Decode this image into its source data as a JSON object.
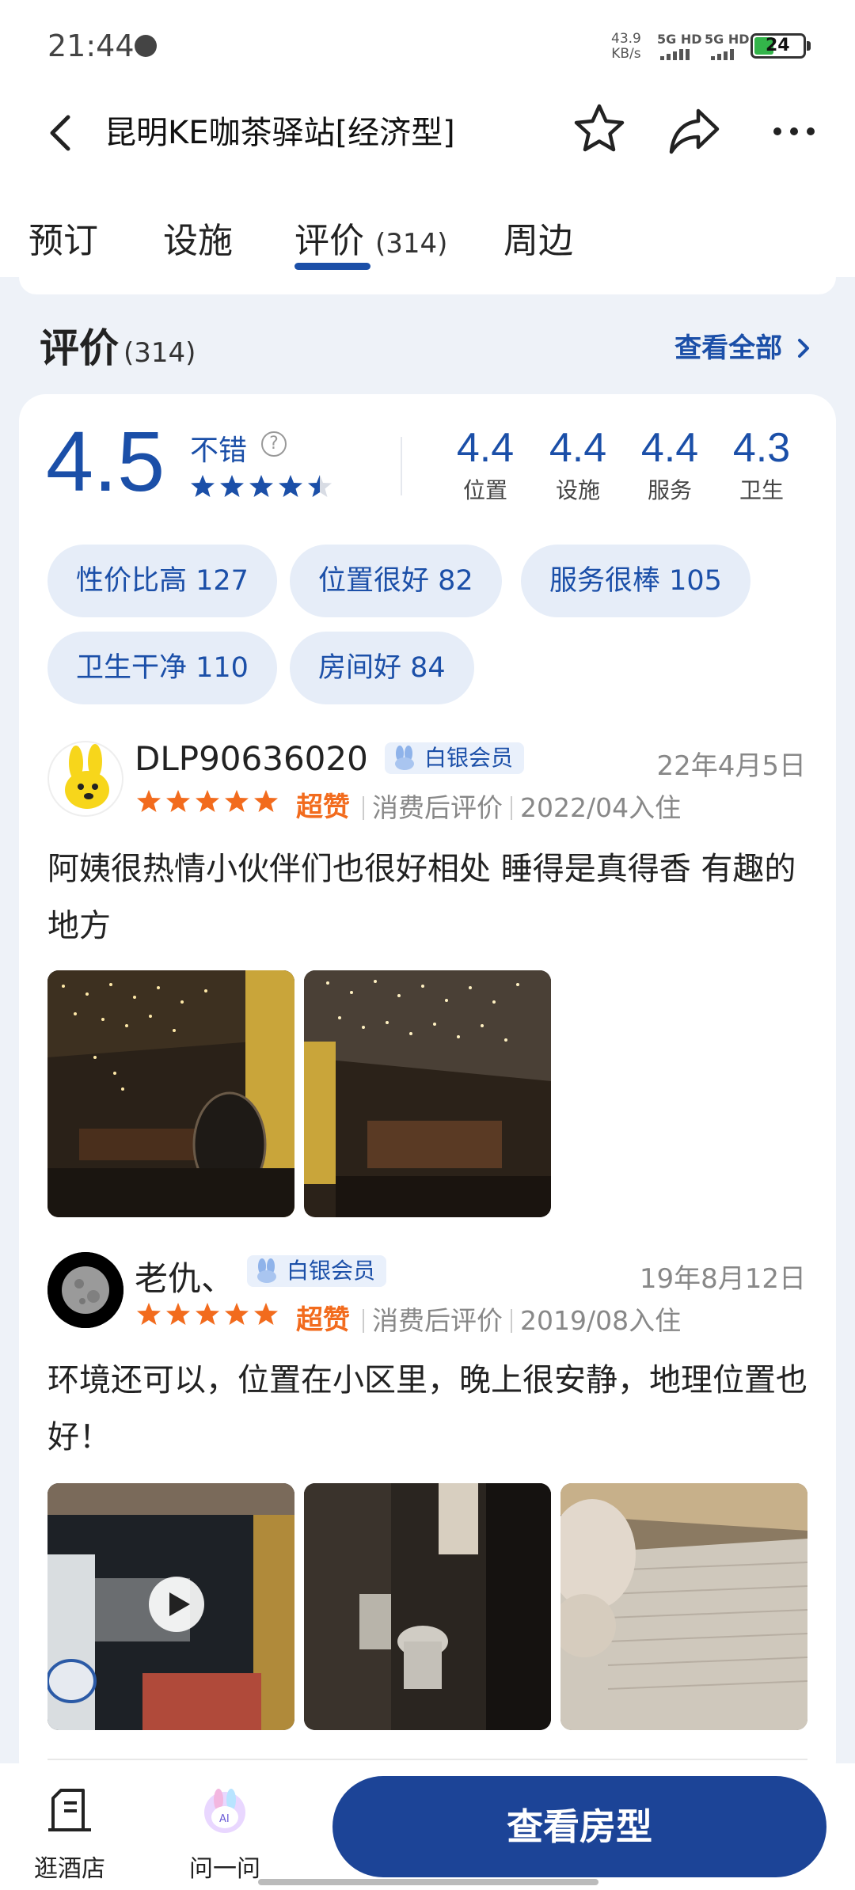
{
  "status_bar": {
    "time": "21:44",
    "speed_value": "43.9",
    "speed_unit": "KB/s",
    "net1": "5G HD",
    "net2": "5G HD",
    "battery": "24",
    "battery_color": "#33b44a"
  },
  "header": {
    "title": "昆明KE咖茶驿站[经济型]",
    "icons": [
      "back-icon",
      "favorite-star-icon",
      "share-icon",
      "more-icon"
    ]
  },
  "tabs": [
    {
      "label": "预订"
    },
    {
      "label": "设施"
    },
    {
      "label": "评价",
      "count": "(314)",
      "active": true
    },
    {
      "label": "周边"
    }
  ],
  "section": {
    "title": "评价",
    "count": "(314)",
    "see_all": "查看全部"
  },
  "rating": {
    "overall": "4.5",
    "word": "不错",
    "stars": 4.5,
    "accent_color": "#1b4fa8",
    "sub_scores": [
      {
        "value": "4.4",
        "label": "位置"
      },
      {
        "value": "4.4",
        "label": "设施"
      },
      {
        "value": "4.4",
        "label": "服务"
      },
      {
        "value": "4.3",
        "label": "卫生"
      }
    ]
  },
  "tags": [
    {
      "label": "性价比高 127"
    },
    {
      "label": "位置很好 82"
    },
    {
      "label": "服务很棒 105"
    },
    {
      "label": "卫生干净 110"
    },
    {
      "label": "房间好 84"
    }
  ],
  "reviews": [
    {
      "username": "DLP90636020",
      "member": "白银会员",
      "date": "22年4月5日",
      "stars": 5,
      "rating_word": "超赞",
      "review_type": "消费后评价",
      "stay": "2022/04入住",
      "text": "阿姨很热情小伙伴们也很好相处 睡得是真得香 有趣的地方",
      "photo_count": 2
    },
    {
      "username": "老仇、",
      "member": "白银会员",
      "date": "19年8月12日",
      "stars": 5,
      "rating_word": "超赞",
      "review_type": "消费后评价",
      "stay": "2019/08入住",
      "text": "环境还可以，位置在小区里，晚上很安静，地理位置也好！",
      "photo_count": 3,
      "has_video": true
    }
  ],
  "bottom_bar": {
    "items": [
      {
        "label": "逛酒店",
        "icon": "hotel-document-icon"
      },
      {
        "label": "问一问",
        "icon": "ai-assistant-icon"
      }
    ],
    "cta": "查看房型",
    "cta_color": "#1c4497"
  }
}
